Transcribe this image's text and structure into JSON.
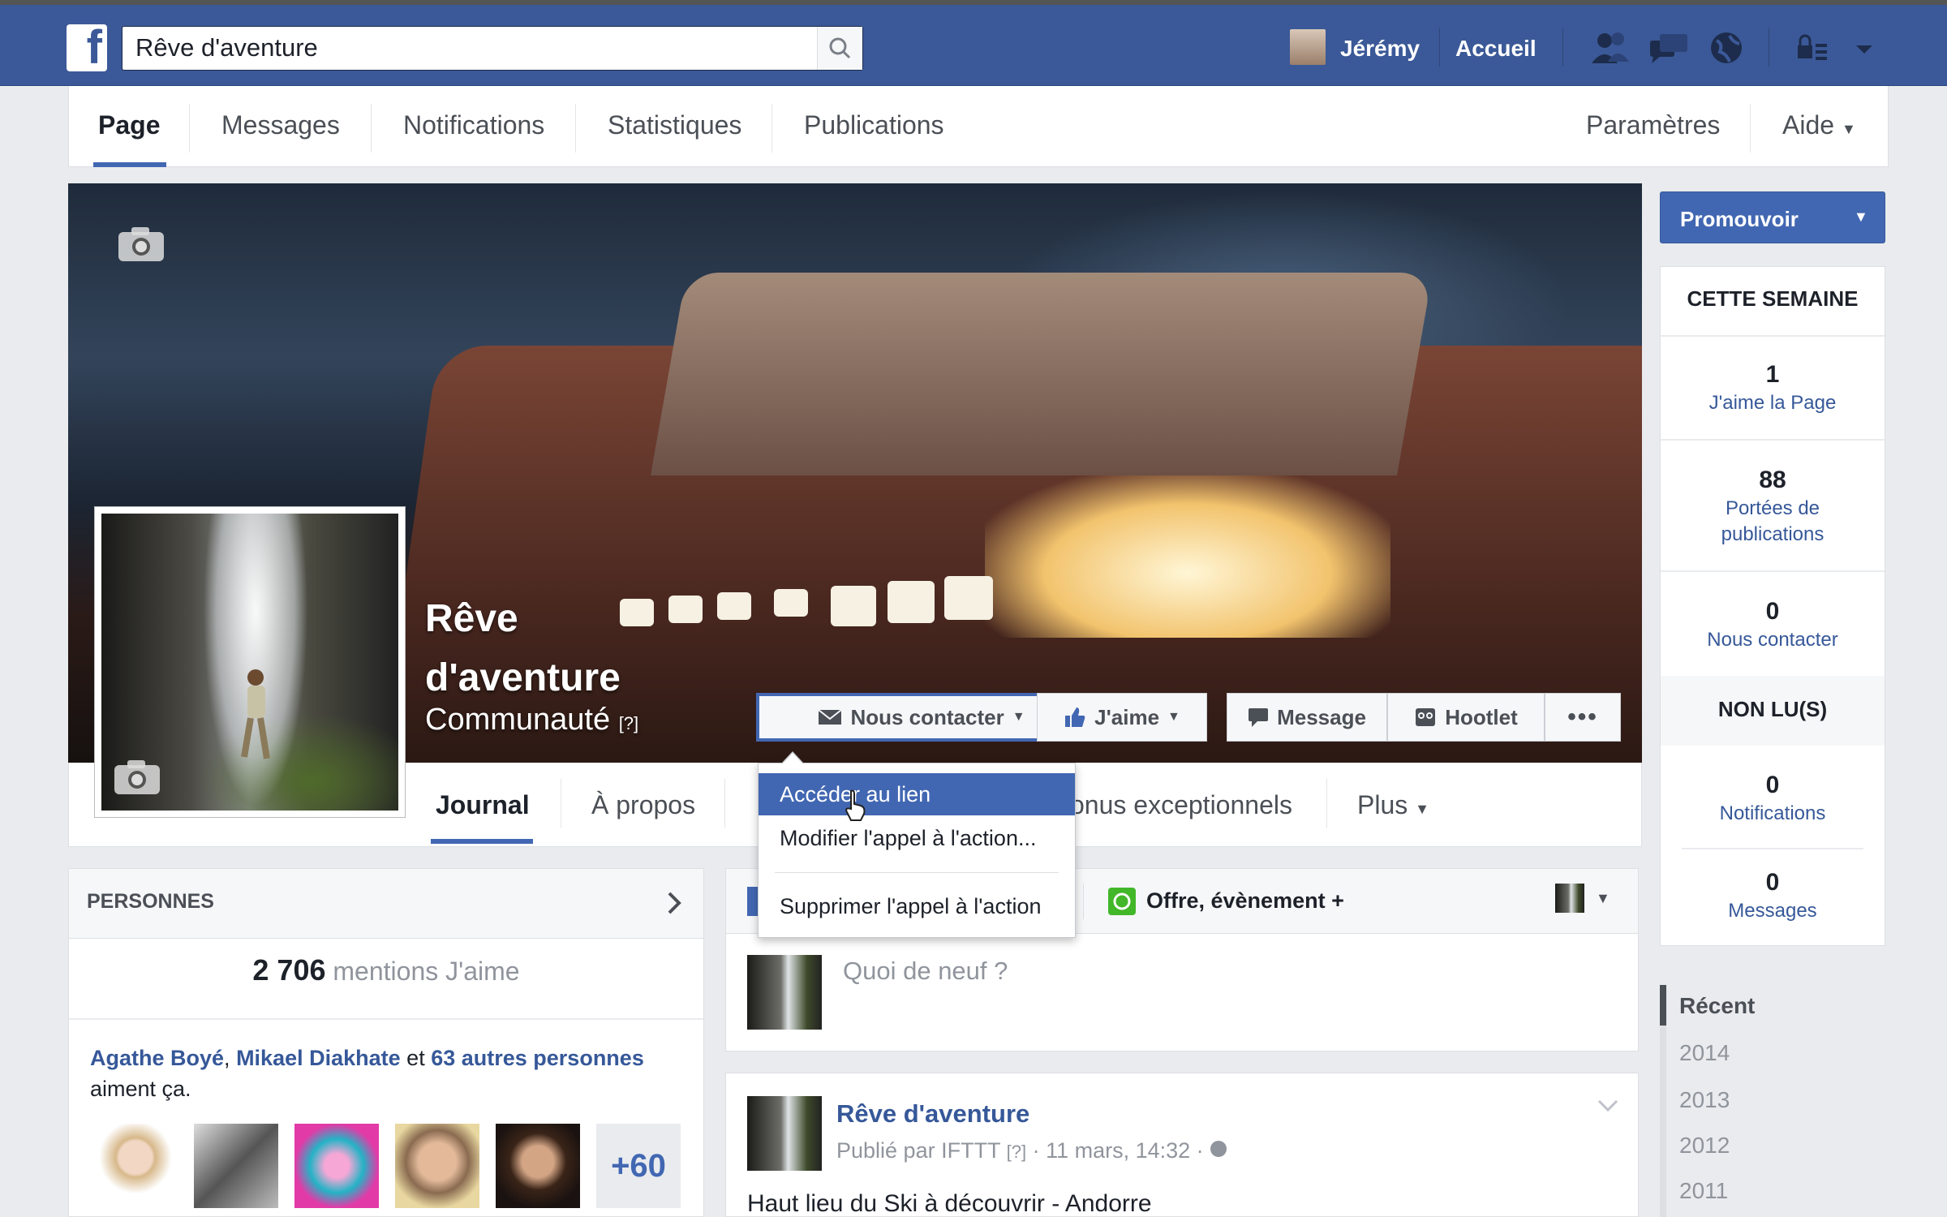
{
  "topbar": {
    "search_value": "Rêve d'aventure",
    "user_name": "Jérémy",
    "home": "Accueil"
  },
  "page_nav": {
    "tabs": [
      "Page",
      "Messages",
      "Notifications",
      "Statistiques",
      "Publications"
    ],
    "settings": "Paramètres",
    "help": "Aide"
  },
  "cover": {
    "name_line1": "Rêve",
    "name_line2": "d'aventure",
    "category": "Communauté",
    "category_help": "[?]",
    "buttons": {
      "contact": "Nous contacter",
      "like": "J'aime",
      "message": "Message",
      "hootlet": "Hootlet",
      "more": "•••"
    }
  },
  "dropdown": {
    "items": [
      "Accéder au lien",
      "Modifier l'appel à l'action...",
      "Supprimer l'appel à l'action"
    ]
  },
  "page_tabs": {
    "journal": "Journal",
    "about": "À propos",
    "bonus": "onus exceptionnels",
    "more": "Plus"
  },
  "promote": "Promouvoir",
  "stats": {
    "week_title": "CETTE SEMAINE",
    "likes_num": "1",
    "likes_label": "J'aime la Page",
    "reach_num": "88",
    "reach_label_1": "Portées de",
    "reach_label_2": "publications",
    "contact_num": "0",
    "contact_label": "Nous contacter",
    "unread_title": "NON LU(S)",
    "notif_num": "0",
    "notif_label": "Notifications",
    "msg_num": "0",
    "msg_label": "Messages"
  },
  "years": [
    "Récent",
    "2014",
    "2013",
    "2012",
    "2011"
  ],
  "people": {
    "title": "PERSONNES",
    "count": "2 706",
    "count_suffix": "mentions J'aime",
    "friend1": "Agathe Boyé",
    "friend2": "Mikael Diakhate",
    "and": "et",
    "others": "63 autres personnes",
    "like_text": "aiment ça.",
    "more_count": "+60"
  },
  "composer": {
    "offer": "Offre, évènement +",
    "placeholder": "Quoi de neuf ?"
  },
  "post": {
    "author": "Rêve d'aventure",
    "meta_prefix": "Publié par IFTTT",
    "meta_help": "[?]",
    "meta_date": "· 11 mars, 14:32 ·",
    "text": "Haut lieu du Ski à découvrir - Andorre"
  }
}
